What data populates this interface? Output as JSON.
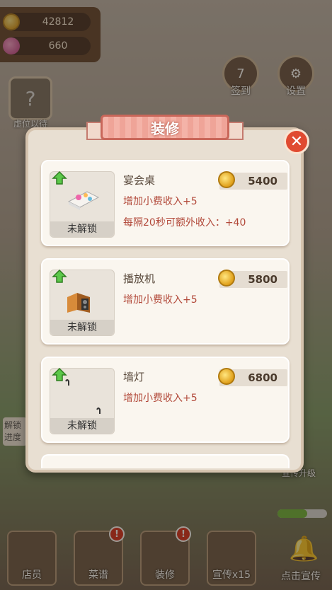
{
  "resources": {
    "coins": "42812",
    "hearts": "660"
  },
  "top_right": {
    "checkin_label": "签到",
    "checkin_day": "7",
    "settings_label": "设置"
  },
  "left_slot": {
    "label": "虚位以待"
  },
  "modal": {
    "title": "装修",
    "items": [
      {
        "name": "宴会桌",
        "price": "5400",
        "status": "未解锁",
        "desc1": "增加小费收入+5",
        "desc2": "每隔20秒可额外收入：+40"
      },
      {
        "name": "播放机",
        "price": "5800",
        "status": "未解锁",
        "desc1": "增加小费收入+5"
      },
      {
        "name": "墙灯",
        "price": "6800",
        "status": "未解锁",
        "desc1": "增加小费收入+5"
      }
    ]
  },
  "side_labels": {
    "left_hint_1": "解锁",
    "left_hint_2": "进度",
    "right_upgrade": "宣传升级"
  },
  "bottom_bar": {
    "staff": "店员",
    "menu": "菜谱",
    "decor": "装修",
    "promo": "宣传x15",
    "click_promo": "点击宣传",
    "badge": "!"
  },
  "colors": {
    "accent_red": "#e04a30",
    "desc_red": "#b2493a",
    "ribbon_pink": "#f4b3a8"
  }
}
